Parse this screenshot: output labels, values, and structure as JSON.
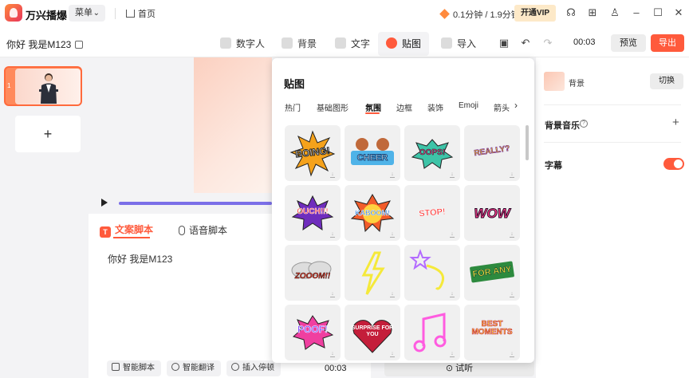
{
  "titlebar": {
    "app_name": "万兴播爆",
    "menu_label": "菜单",
    "home_label": "首页",
    "vip_time": "0.1分钟 / 1.9分钟",
    "vip_button": "开通VIP"
  },
  "project": {
    "name": "你好 我是M123"
  },
  "tools": {
    "tabs": [
      {
        "label": "数字人"
      },
      {
        "label": "背景"
      },
      {
        "label": "文字"
      },
      {
        "label": "贴图"
      },
      {
        "label": "导入"
      }
    ],
    "time": "00:03",
    "preview_label": "预览",
    "export_label": "导出"
  },
  "slides": {
    "first_number": "1",
    "add_label": "+"
  },
  "script": {
    "tab_text": "文案脚本",
    "tab_voice": "语音脚本",
    "content": "你好 我是M123",
    "buttons": [
      "智能脚本",
      "智能翻译",
      "插入停顿"
    ],
    "time": "00:03",
    "audition_label": "试听"
  },
  "right_panel": {
    "background_label": "背景",
    "switch_label": "切换",
    "bgm_label": "背景音乐",
    "bgm_help": "?",
    "bgm_add": "+",
    "subtitle_label": "字幕",
    "subtitle_on": true
  },
  "sticker_panel": {
    "title": "贴图",
    "categories": [
      "热门",
      "基础图形",
      "氛围",
      "边框",
      "装饰",
      "Emoji",
      "箭头"
    ],
    "active_category": "氛围",
    "stickers": [
      {
        "text": "BOING!"
      },
      {
        "text": "CHEER"
      },
      {
        "text": "OOPS!"
      },
      {
        "text": "REALLY?"
      },
      {
        "text": "OUCH!!!"
      },
      {
        "text": "KABOOM!"
      },
      {
        "text": "STOP!"
      },
      {
        "text": "WOW"
      },
      {
        "text": "ZOOOM!!"
      },
      {
        "text": "",
        "icon": "neon-lightning-icon"
      },
      {
        "text": "",
        "icon": "neon-star-icon"
      },
      {
        "text": "FOR ANY"
      },
      {
        "text": "POOF!"
      },
      {
        "text": "SURPRISE FOR YOU"
      },
      {
        "text": "",
        "icon": "neon-music-note-icon"
      },
      {
        "text": "BEST MOMENTS"
      }
    ]
  },
  "colors": {
    "accent": "#ff5a3c",
    "progress": "#7b6fe8"
  }
}
